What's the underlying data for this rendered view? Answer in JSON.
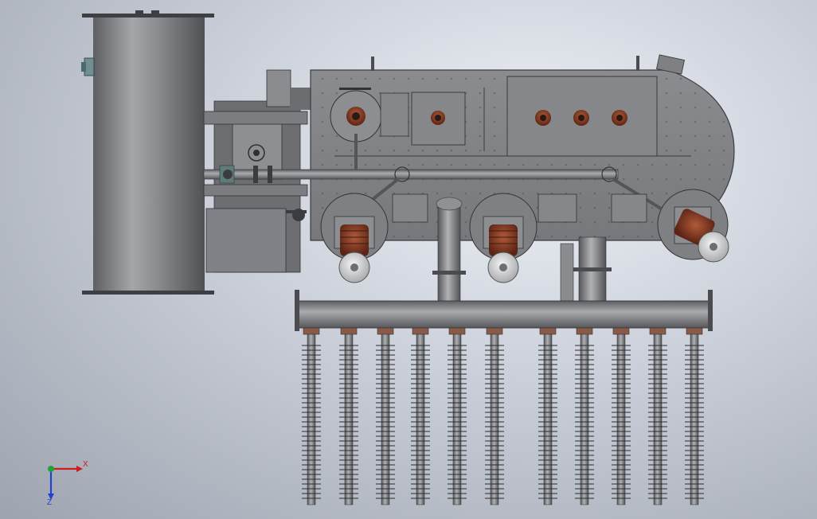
{
  "viewport": {
    "background": "#c9ced8",
    "model_color": "#7d7f84",
    "dark_color": "#4a4c50",
    "insulator_color": "#7a3a24"
  },
  "triad": {
    "x_label": "X",
    "z_label": "Z",
    "x_color": "#d01c1c",
    "y_color": "#1fa63a",
    "z_color": "#2243c9"
  },
  "model": {
    "tank_icon": "vertical-cylinder-tank",
    "housing_icon": "rounded-rect-housing",
    "bushing_icon": "porcelain-bushing",
    "electrode_count": 11
  }
}
